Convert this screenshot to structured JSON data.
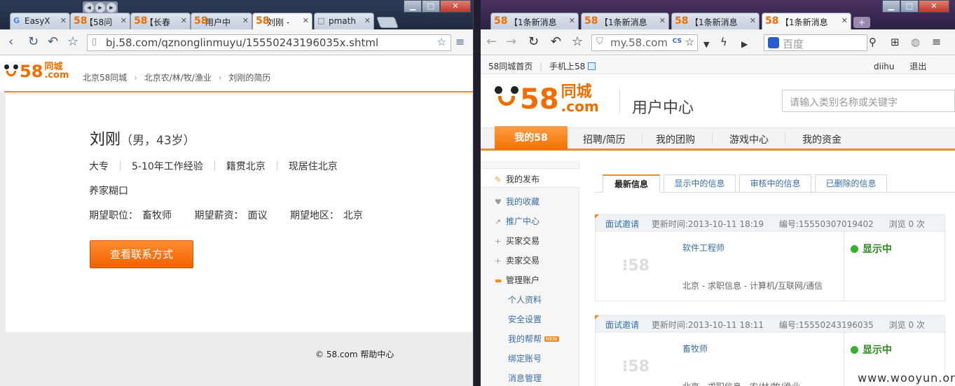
{
  "left": {
    "tabs": [
      {
        "fav": "G",
        "title": "EasyX"
      },
      {
        "fav": "58",
        "title": "【58问"
      },
      {
        "fav": "58",
        "title": "【长春"
      },
      {
        "fav": "58",
        "title": "用户中"
      },
      {
        "fav": "58",
        "title": "刘刚 -"
      },
      {
        "fav": "□",
        "title": "pmath"
      }
    ],
    "url": "bj.58.com/qznonglinmuyu/15550243196035x.shtml",
    "logo": {
      "num": "58",
      "cn": "同城",
      "com": ".com"
    },
    "breadcrumb": [
      "北京58同城",
      "北京农/林/牧/渔业",
      "刘刚的简历"
    ],
    "resume": {
      "name": "刘刚",
      "meta": "（男，43岁）",
      "facts": [
        "大专",
        "5-10年工作经验",
        "籍贯北京",
        "现居住北京"
      ],
      "summary": "养家糊口",
      "expect": [
        {
          "label": "期望职位：",
          "value": "畜牧师"
        },
        {
          "label": "期望薪资：",
          "value": "面议"
        },
        {
          "label": "期望地区：",
          "value": "北京"
        }
      ],
      "contact_button": "查看联系方式"
    },
    "footer": {
      "copy": "© 58.com",
      "help": "帮助中心"
    }
  },
  "right": {
    "tabs": [
      {
        "fav": "58",
        "title": "【1条新消息"
      },
      {
        "fav": "58",
        "title": "【1条新消息"
      },
      {
        "fav": "58",
        "title": "【1条新消息"
      },
      {
        "fav": "58",
        "title": "【1条新消息"
      }
    ],
    "url": "my.58.com",
    "search_engine": "百度",
    "topbar": {
      "home": "58同城首页",
      "mobile": "手机上58",
      "user": "diihu",
      "logout": "退出"
    },
    "logo": {
      "num": "58",
      "cn": "同城",
      "com": ".com"
    },
    "center_title": "用户中心",
    "search_placeholder": "请输入类别名称或关键字",
    "nav": [
      "我的58",
      "招聘/简历",
      "我的团购",
      "游戏中心",
      "我的资金"
    ],
    "sidebar": [
      {
        "icon": "✎",
        "label": "我的发布"
      },
      {
        "icon": "♥",
        "label": "我的收藏"
      },
      {
        "icon": "↗",
        "label": "推广中心"
      },
      {
        "icon": "+",
        "label": "买家交易"
      },
      {
        "icon": "+",
        "label": "卖家交易"
      },
      {
        "icon": "▬",
        "label": "管理账户"
      },
      {
        "icon": "",
        "label": "个人资料"
      },
      {
        "icon": "",
        "label": "安全设置"
      },
      {
        "icon": "",
        "label": "我的帮帮",
        "badge": "NEW"
      },
      {
        "icon": "",
        "label": "绑定账号"
      },
      {
        "icon": "",
        "label": "消息管理"
      }
    ],
    "subtabs": [
      "最新信息",
      "显示中的信息",
      "审核中的信息",
      "已删除的信息"
    ],
    "posts": [
      {
        "invite": "面试邀请",
        "updated": "更新时间:2013-10-11 18:19",
        "id": "编号:15550307019402",
        "views": "浏览 0 次",
        "title": "软件工程师",
        "category": "北京 - 求职信息 - 计算机/互联网/通信",
        "status": "显示中"
      },
      {
        "invite": "面试邀请",
        "updated": "更新时间:2013-10-11 18:11",
        "id": "编号:15550243196035",
        "views": "浏览 0 次",
        "title": "畜牧师",
        "category": "北京 - 求职信息 - 农/林/牧/渔业",
        "status": "显示中"
      }
    ],
    "watermark": "www.wooyun.org"
  }
}
